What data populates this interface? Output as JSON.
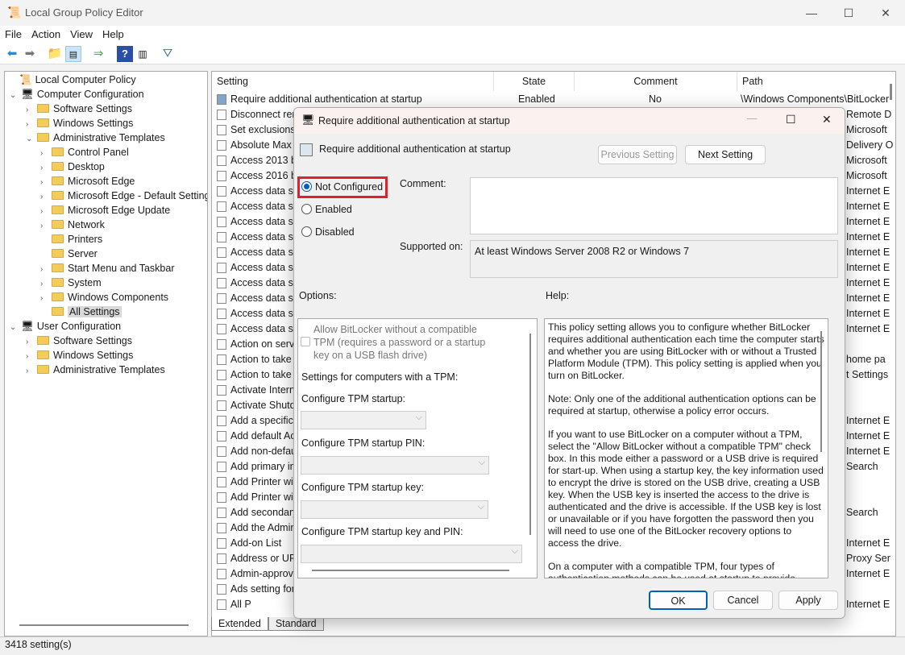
{
  "window": {
    "title": "Local Group Policy Editor",
    "minimize": "—",
    "maximize": "☐",
    "close": "✕"
  },
  "menu": [
    "File",
    "Action",
    "View",
    "Help"
  ],
  "toolbar": [
    "back-icon",
    "forward-icon",
    "up-folder-icon",
    "show-hide-tree-icon",
    "export-list-icon",
    "help-icon",
    "show-hide-action-pane-icon",
    "filter-icon"
  ],
  "tree": [
    {
      "label": "Local Computer Policy",
      "level": 0,
      "arrow": ""
    },
    {
      "label": "Computer Configuration",
      "level": 1,
      "arrow": "⌄"
    },
    {
      "label": "Software Settings",
      "level": 2,
      "arrow": "›"
    },
    {
      "label": "Windows Settings",
      "level": 2,
      "arrow": "›"
    },
    {
      "label": "Administrative Templates",
      "level": 2,
      "arrow": "⌄"
    },
    {
      "label": "Control Panel",
      "level": 3,
      "arrow": "›"
    },
    {
      "label": "Desktop",
      "level": 3,
      "arrow": "›"
    },
    {
      "label": "Microsoft Edge",
      "level": 3,
      "arrow": "›"
    },
    {
      "label": "Microsoft Edge - Default Settings",
      "level": 3,
      "arrow": "›"
    },
    {
      "label": "Microsoft Edge Update",
      "level": 3,
      "arrow": "›"
    },
    {
      "label": "Network",
      "level": 3,
      "arrow": "›"
    },
    {
      "label": "Printers",
      "level": 3,
      "arrow": ""
    },
    {
      "label": "Server",
      "level": 3,
      "arrow": ""
    },
    {
      "label": "Start Menu and Taskbar",
      "level": 3,
      "arrow": "›"
    },
    {
      "label": "System",
      "level": 3,
      "arrow": "›"
    },
    {
      "label": "Windows Components",
      "level": 3,
      "arrow": "›"
    },
    {
      "label": "All Settings",
      "level": 3,
      "arrow": "",
      "selected": true
    },
    {
      "label": "User Configuration",
      "level": 1,
      "arrow": "⌄"
    },
    {
      "label": "Software Settings",
      "level": 2,
      "arrow": "›"
    },
    {
      "label": "Windows Settings",
      "level": 2,
      "arrow": "›"
    },
    {
      "label": "Administrative Templates",
      "level": 2,
      "arrow": "›"
    }
  ],
  "list": {
    "headers": [
      "Setting",
      "State",
      "Comment",
      "Path"
    ],
    "rows": [
      {
        "name": "Require additional authentication at startup",
        "state": "Enabled",
        "comment": "No",
        "path": "\\Windows Components\\BitLocker"
      },
      {
        "name": "Disconnect rer",
        "path": "Remote D"
      },
      {
        "name": "Set exclusions",
        "path": "Microsoft"
      },
      {
        "name": "Absolute Max",
        "path": "Delivery O"
      },
      {
        "name": "Access 2013 ba",
        "path": "Microsoft"
      },
      {
        "name": "Access 2016 ba",
        "path": "Microsoft"
      },
      {
        "name": "Access data sou",
        "path": "Internet E"
      },
      {
        "name": "Access data sou",
        "path": "Internet E"
      },
      {
        "name": "Access data sou",
        "path": "Internet E"
      },
      {
        "name": "Access data sou",
        "path": "Internet E"
      },
      {
        "name": "Access data sou",
        "path": "Internet E"
      },
      {
        "name": "Access data sou",
        "path": "Internet E"
      },
      {
        "name": "Access data sou",
        "path": "Internet E"
      },
      {
        "name": "Access data sou",
        "path": "Internet E"
      },
      {
        "name": "Access data sou",
        "path": "Internet E"
      },
      {
        "name": "Access data sou",
        "path": "Internet E"
      },
      {
        "name": "Action on serve",
        "path": ""
      },
      {
        "name": "Action to take",
        "path": "home pa"
      },
      {
        "name": "Action to take",
        "path": "t Settings"
      },
      {
        "name": "Activate Interne",
        "path": ""
      },
      {
        "name": "Activate Shutdo",
        "path": ""
      },
      {
        "name": "Add a specific l",
        "path": "Internet E"
      },
      {
        "name": "Add default Ac",
        "path": "Internet E"
      },
      {
        "name": "Add non-defau",
        "path": "Internet E"
      },
      {
        "name": "Add primary in",
        "path": "Search"
      },
      {
        "name": "Add Printer wiz",
        "path": ""
      },
      {
        "name": "Add Printer wiz",
        "path": ""
      },
      {
        "name": "Add secondary",
        "path": "Search"
      },
      {
        "name": "Add the Admin",
        "path": ""
      },
      {
        "name": "Add-on List",
        "path": "Internet E"
      },
      {
        "name": "Address or URL",
        "path": "Proxy Ser"
      },
      {
        "name": "Admin-approv",
        "path": "Internet E"
      },
      {
        "name": "Ads setting for",
        "path": ""
      },
      {
        "name": "All P",
        "path": "Internet E"
      }
    ],
    "tabs": [
      "Extended",
      "Standard"
    ],
    "active_tab": "Extended"
  },
  "status": "3418 setting(s)",
  "dialog": {
    "title": "Require additional authentication at startup",
    "policy_name": "Require additional authentication at startup",
    "previous_label": "Previous Setting",
    "next_label": "Next Setting",
    "radios": [
      "Not Configured",
      "Enabled",
      "Disabled"
    ],
    "selected": "Not Configured",
    "highlight_color": "#e0202c",
    "comment_label": "Comment:",
    "comment_value": "",
    "supported_label": "Supported on:",
    "supported_value": "At least Windows Server 2008 R2 or Windows 7",
    "options_label": "Options:",
    "help_label": "Help:",
    "options": {
      "allow_checkbox": "Allow BitLocker without a compatible TPM (requires a password or a startup key on a USB flash drive)",
      "allow_checked": false,
      "tpm_heading": "Settings for computers with a TPM:",
      "tpm_startup": "Configure TPM startup:",
      "tpm_pin": "Configure TPM startup PIN:",
      "tpm_key": "Configure TPM startup key:",
      "tpm_key_pin": "Configure TPM startup key and PIN:"
    },
    "help": [
      "This policy setting allows you to configure whether BitLocker requires additional authentication each time the computer starts and whether you are using BitLocker with or without a Trusted Platform Module (TPM). This policy setting is applied when you turn on BitLocker.",
      "Note: Only one of the additional authentication options can be required at startup, otherwise a policy error occurs.",
      "If you want to use BitLocker on a computer without a TPM, select the \"Allow BitLocker without a compatible TPM\" check box. In this mode either a password or a USB drive is required for start-up. When using a startup key, the key information used to encrypt the drive is stored on the USB drive, creating a USB key. When the USB key is inserted the access to the drive is authenticated and the drive is accessible. If the USB key is lost or unavailable or if you have forgotten the password then you will need to use one of the BitLocker recovery options to access the drive.",
      "On a computer with a compatible TPM, four types of authentication methods can be used at startup to provide added protection for encrypted data."
    ],
    "ok": "OK",
    "cancel": "Cancel",
    "apply": "Apply"
  }
}
